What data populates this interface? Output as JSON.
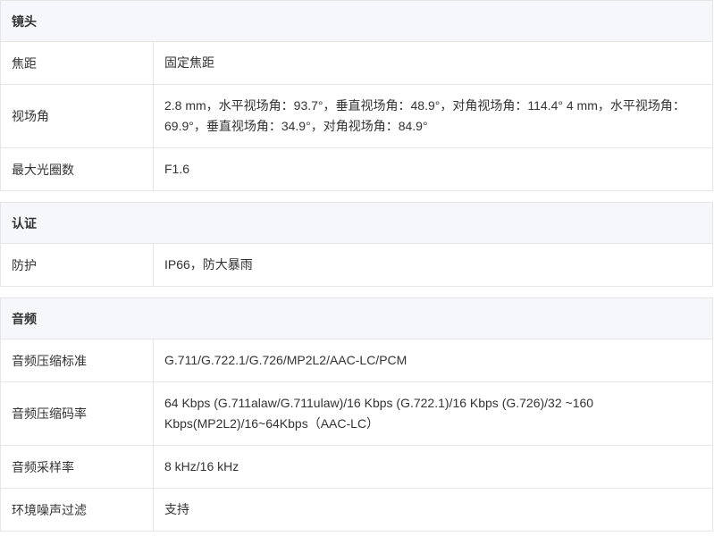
{
  "sections": [
    {
      "title": "镜头",
      "rows": [
        {
          "label": "焦距",
          "value": "固定焦距"
        },
        {
          "label": "视场角",
          "value": "2.8 mm，水平视场角：93.7°，垂直视场角：48.9°，对角视场角：114.4° 4 mm，水平视场角：69.9°，垂直视场角：34.9°，对角视场角：84.9°"
        },
        {
          "label": "最大光圈数",
          "value": "F1.6"
        }
      ]
    },
    {
      "title": "认证",
      "rows": [
        {
          "label": "防护",
          "value": "IP66，防大暴雨"
        }
      ]
    },
    {
      "title": "音频",
      "rows": [
        {
          "label": "音频压缩标准",
          "value": "G.711/G.722.1/G.726/MP2L2/AAC-LC/PCM"
        },
        {
          "label": "音频压缩码率",
          "value": "64 Kbps (G.711alaw/G.711ulaw)/16 Kbps (G.722.1)/16 Kbps (G.726)/32 ~160 Kbps(MP2L2)/16~64Kbps（AAC-LC）"
        },
        {
          "label": "音频采样率",
          "value": "8 kHz/16 kHz"
        },
        {
          "label": "环境噪声过滤",
          "value": "支持"
        }
      ]
    }
  ]
}
